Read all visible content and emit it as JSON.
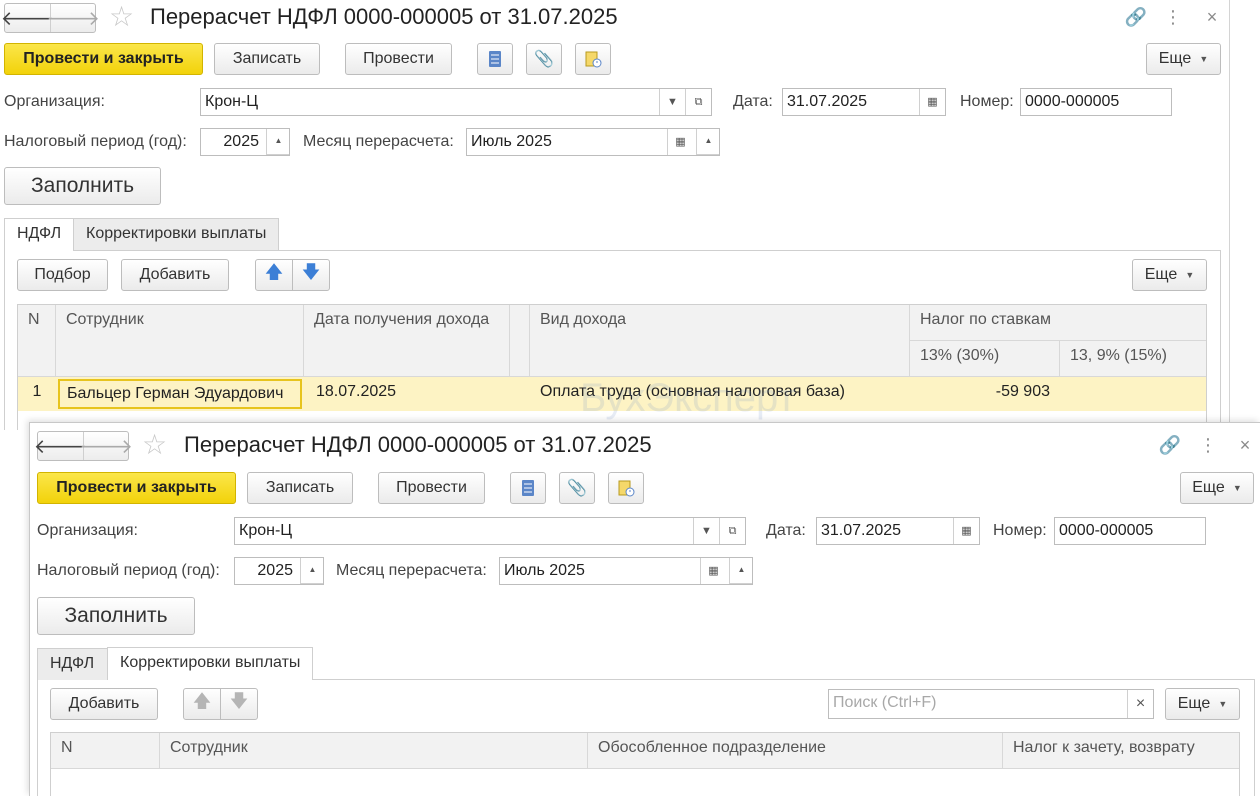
{
  "doc_title": "Перерасчет НДФЛ 0000-000005 от 31.07.2025",
  "toolbar": {
    "post_close": "Провести и закрыть",
    "save": "Записать",
    "post": "Провести",
    "more": "Еще"
  },
  "header": {
    "org_label": "Организация:",
    "org_value": "Крон-Ц",
    "date_label": "Дата:",
    "date_value": "31.07.2025",
    "number_label": "Номер:",
    "number_value": "0000-000005",
    "period_label": "Налоговый период (год):",
    "period_value": "2025",
    "month_label": "Месяц перерасчета:",
    "month_value": "Июль 2025",
    "fill_button": "Заполнить"
  },
  "tabs": {
    "ndfl": "НДФЛ",
    "corrections": "Корректировки выплаты"
  },
  "ndfl_tab": {
    "pick_button": "Подбор",
    "add_button": "Добавить",
    "more": "Еще",
    "columns": {
      "n": "N",
      "employee": "Сотрудник",
      "income_date": "Дата получения дохода",
      "income_type": "Вид дохода",
      "tax_by_rates": "Налог по ставкам",
      "rate_13": "13% (30%)",
      "rate_15": "13, 9% (15%)"
    },
    "rows": [
      {
        "n": "1",
        "employee": "Бальцер Герман Эдуардович",
        "income_date": "18.07.2025",
        "income_type": "Оплата труда (основная налоговая база)",
        "rate_13": "-59 903",
        "rate_15": ""
      }
    ]
  },
  "corrections_tab": {
    "add_button": "Добавить",
    "search_placeholder": "Поиск (Ctrl+F)",
    "more": "Еще",
    "columns": {
      "n": "N",
      "employee": "Сотрудник",
      "division": "Обособленное подразделение",
      "tax_credit": "Налог к зачету, возврату"
    }
  },
  "watermark": "БухЭксперт"
}
